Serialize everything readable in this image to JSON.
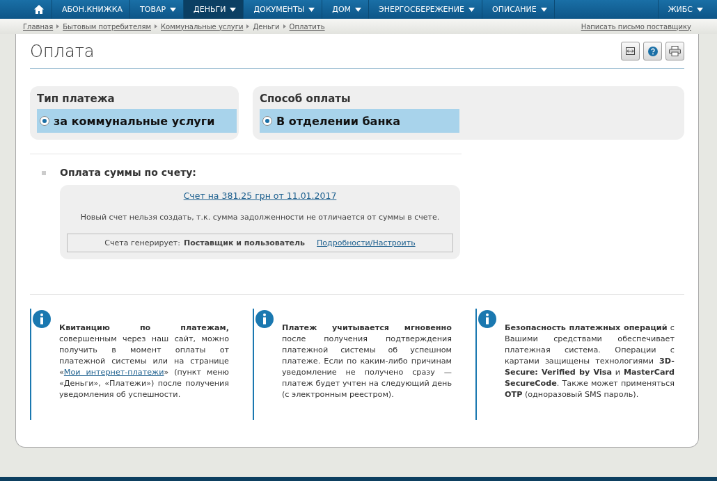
{
  "nav": {
    "items": [
      {
        "label": "АБОН.КНИЖКА",
        "dropdown": false,
        "selected": false
      },
      {
        "label": "ТОВАР",
        "dropdown": true,
        "selected": false
      },
      {
        "label": "ДЕНЬГИ",
        "dropdown": true,
        "selected": true
      },
      {
        "label": "ДОКУМЕНТЫ",
        "dropdown": true,
        "selected": false
      },
      {
        "label": "ДОМ",
        "dropdown": true,
        "selected": false
      },
      {
        "label": "ЭНЕРГОСБЕРЕЖЕНИЕ",
        "dropdown": true,
        "selected": false
      },
      {
        "label": "ОПИСАНИЕ",
        "dropdown": true,
        "selected": false
      }
    ],
    "right": {
      "label": "ЖИБС",
      "dropdown": true,
      "selected": false
    }
  },
  "breadcrumbs": [
    {
      "label": "Главная",
      "link": true
    },
    {
      "label": "Бытовым потребителям",
      "link": true
    },
    {
      "label": "Коммунальные услуги",
      "link": true
    },
    {
      "label": "Деньги",
      "link": false
    },
    {
      "label": "Оплатить",
      "link": true
    }
  ],
  "write_link": "Написать письмо поставщику",
  "title": "Оплата",
  "choices": [
    {
      "heading": "Тип платежа",
      "option": "за коммунальные услуги",
      "selected": true
    },
    {
      "heading": "Способ оплаты",
      "option": "В отделении банка",
      "selected": true
    }
  ],
  "invoice": {
    "heading": "Оплата суммы по счету:",
    "link": "Счет на 381.25 грн от 11.01.2017",
    "note": "Новый счет нельзя создать, т.к. сумма задолженности не отличается от суммы в счете.",
    "generator_label": "Счета генерирует:",
    "generator_value": "Поставщик и пользователь",
    "settings_link": "Подробности/Настроить"
  },
  "info": [
    {
      "parts": [
        {
          "kind": "text",
          "text": "**Квитанцию по платежам,** совершенным через наш сайт, можно получить в момент оплаты от платежной системы или на странице «"
        },
        {
          "kind": "link",
          "text": "Мои интернет-платежи"
        },
        {
          "kind": "text",
          "text": "» (пункт меню «Деньги», «Платежи») после получения уведомления об успешности."
        }
      ]
    },
    {
      "parts": [
        {
          "kind": "text",
          "text": "**Платеж учитывается мгновенно** после получения подтверждения платежной системы об успешном платеже. Если по каким-либо причинам уведомление не получено сразу — платеж будет учтен на следующий день (с электронным реестром)."
        }
      ]
    },
    {
      "parts": [
        {
          "kind": "text",
          "text": "**Безопасность платежных операций** с Вашими средствами обеспечивает платежная система. Операции с картами защищены технологиями **3D-Secure: Verified by Visa** и **MasterCard SecureCode**. Также может применяться **OTP** (одноразовый SMS пароль)."
        }
      ]
    }
  ]
}
